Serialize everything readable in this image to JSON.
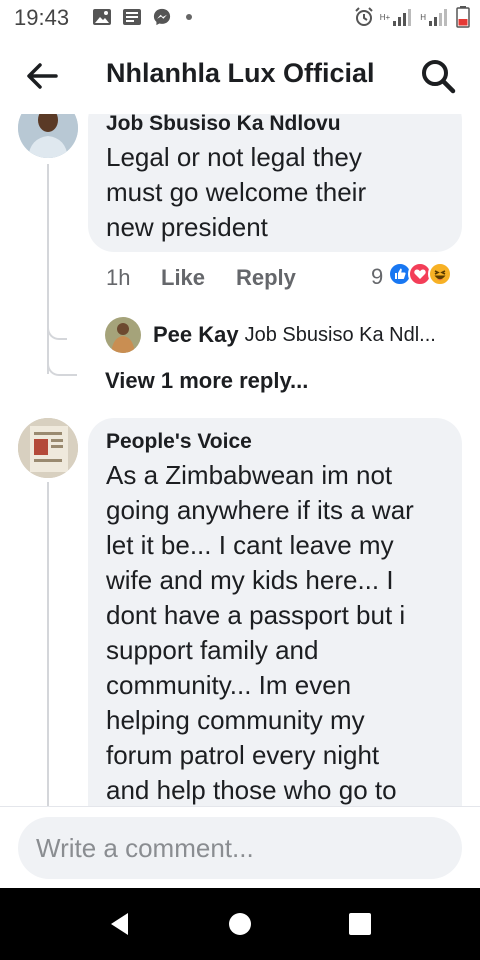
{
  "status_bar": {
    "time": "19:43",
    "network_label_1": "H+",
    "network_label_2": "H"
  },
  "header": {
    "title": "Nhlanhla Lux Official"
  },
  "comments": [
    {
      "author": "Job Sbusiso Ka Ndlovu",
      "text_lines": [
        "Legal or not legal they",
        "must go welcome their",
        "new president"
      ],
      "time": "1h",
      "like_label": "Like",
      "reply_label": "Reply",
      "reaction_count": "9",
      "reactions": [
        "like-icon",
        "love-icon",
        "haha-icon"
      ],
      "reply_preview": {
        "author": "Pee Kay",
        "snippet": "Job Sbusiso Ka Ndl..."
      },
      "more_replies": "View 1 more reply..."
    },
    {
      "author": "People's Voice",
      "text_lines": [
        "As a Zimbabwean im not",
        "going anywhere if its a war",
        "let it be... I cant leave my",
        "wife and my kids here... I",
        "dont have a passport but i",
        "support family and",
        "community... Im even",
        "helping community my",
        "forum patrol every night",
        "and help those who go to"
      ]
    }
  ],
  "composer": {
    "placeholder": "Write a comment..."
  },
  "colors": {
    "bubble": "#f0f2f5",
    "like": "#1877f2",
    "love": "#f33e58",
    "haha": "#f7b125"
  }
}
